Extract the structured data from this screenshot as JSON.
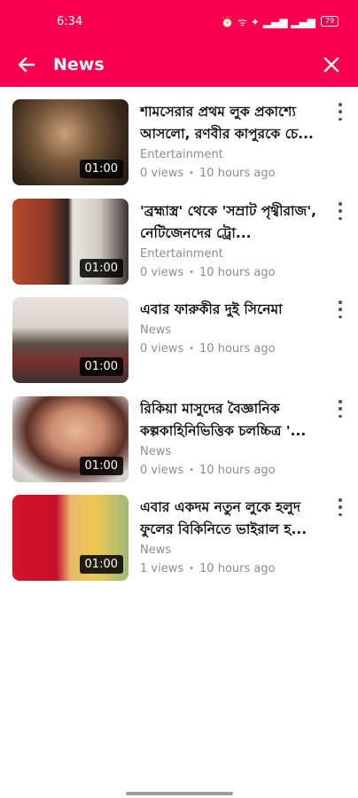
{
  "status": {
    "time": "6:34",
    "icons": "⏰ ᯤ ✦ ▂▄▆ ▂▄▆",
    "battery": "79"
  },
  "appbar": {
    "title": "News",
    "back_icon": "arrow-left-icon",
    "close_icon": "close-icon"
  },
  "colors": {
    "brand": "#f8004f",
    "meta": "#8d8d8d"
  },
  "videos": [
    {
      "title": "শামসেরার প্রথম লুক প্রকাশ্যে আসলো, রণবীর কাপুরকে চে...",
      "category": "Entertainment",
      "views": "0 views",
      "sep": "•",
      "age": "10 hours ago",
      "duration": "01:00"
    },
    {
      "title": "'ব্রহ্মাস্ত্র' থেকে 'সম্রাট পৃথ্বীরাজ', নেটিজেনদের ট্রো...",
      "category": "Entertainment",
      "views": "0 views",
      "sep": "•",
      "age": "10 hours ago",
      "duration": "01:00"
    },
    {
      "title": "এবার ফারুকীর দুই সিনেমা",
      "category": "News",
      "views": "0 views",
      "sep": "•",
      "age": "10 hours ago",
      "duration": "01:00"
    },
    {
      "title": "রিকিয়া মাসুদের বৈজ্ঞানিক কল্পকাহিনিভিত্তিক চলচ্চিত্র '...",
      "category": "News",
      "views": "0 views",
      "sep": "•",
      "age": "10 hours ago",
      "duration": "01:00"
    },
    {
      "title": "এবার একদম নতুন লুকে হলুদ ফুলের বিকিনিতে ভাইরাল হ...",
      "category": "News",
      "views": "1 views",
      "sep": "•",
      "age": "10 hours ago",
      "duration": "01:00"
    }
  ]
}
